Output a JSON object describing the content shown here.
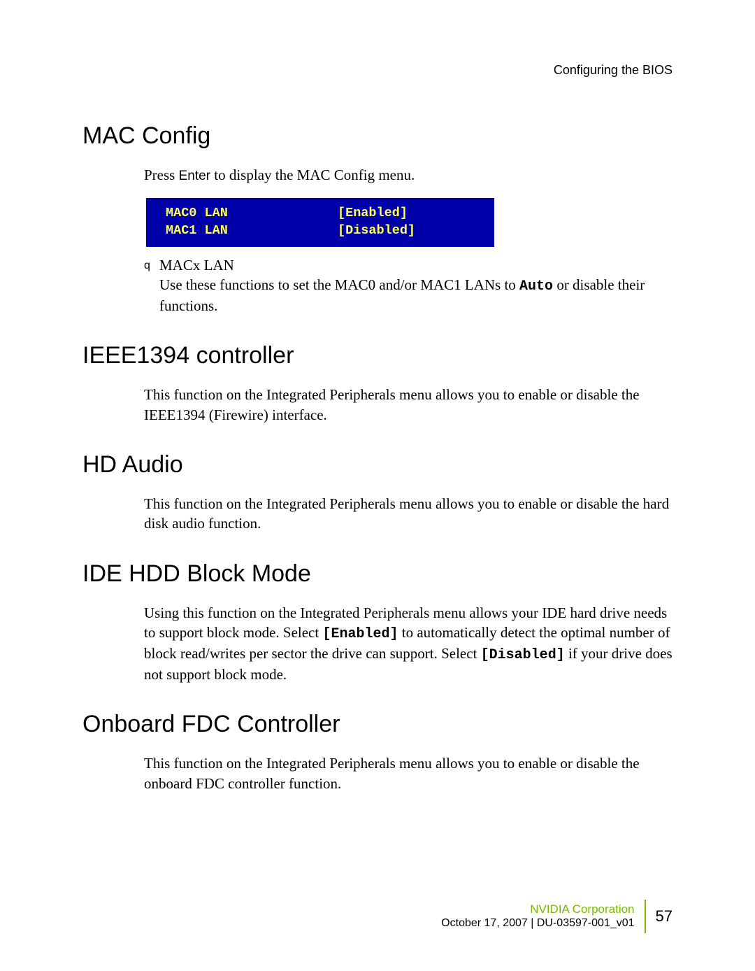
{
  "header": {
    "running": "Configuring the BIOS"
  },
  "sections": {
    "mac_config": {
      "heading": "MAC Config",
      "intro_pre": "Press ",
      "intro_key": "Enter",
      "intro_post": " to display the MAC Config menu.",
      "bios": {
        "row0": {
          "label": "MAC0 LAN",
          "value": "[Enabled]"
        },
        "row1": {
          "label": "MAC1 LAN",
          "value": "[Disabled]"
        }
      },
      "bullet": {
        "mark": "q",
        "title": "MACx LAN",
        "body_pre": "Use these functions to set the MAC0 and/or MAC1 LANs to ",
        "body_code": "Auto",
        "body_post": " or disable their functions."
      }
    },
    "ieee": {
      "heading": "IEEE1394 controller",
      "body": "This function on the Integrated Peripherals menu allows you to enable or disable the IEEE1394 (Firewire) interface."
    },
    "hd_audio": {
      "heading": "HD Audio",
      "body": "This function on the Integrated Peripherals menu allows you to enable or disable the hard disk audio function."
    },
    "ide": {
      "heading": "IDE HDD Block Mode",
      "p1_pre": "Using this function on the Integrated Peripherals menu allows your IDE hard drive needs to support block mode. Select ",
      "p1_code1": "[Enabled]",
      "p1_mid": " to automatically detect the optimal number of block read/writes per sector the drive can support. Select ",
      "p1_code2": "[Disabled]",
      "p1_post": " if your drive does not support block mode."
    },
    "fdc": {
      "heading": "Onboard FDC Controller",
      "body": "This function on the Integrated Peripherals menu allows you to enable or disable the onboard FDC controller function."
    }
  },
  "footer": {
    "corp": "NVIDIA Corporation",
    "dateline": "October 17, 2007  |  DU-03597-001_v01",
    "page": "57"
  }
}
